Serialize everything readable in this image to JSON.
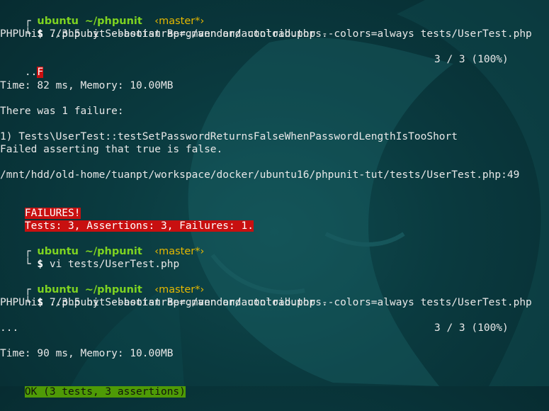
{
  "colors": {
    "prompt_user": "#7ed321",
    "prompt_branch": "#e6b800",
    "failure_bg": "#c81010",
    "ok_bg": "#4e9a06",
    "background": "#0a3a3f"
  },
  "prompt": {
    "user": "ubuntu",
    "path": "~/phpunit",
    "branch": "‹master*›",
    "symbol": "$"
  },
  "run1": {
    "command": "./phpunit --bootstrap=./vendor/autoload.php --colors=always tests/UserTest.php",
    "version_line": "PHPUnit 7.3.5 by Sebastian Bergmann and contributors.",
    "progress_dots": "..",
    "progress_fail": "F",
    "progress_count": "3 / 3 (100%)",
    "time_line": "Time: 82 ms, Memory: 10.00MB",
    "failure_header": "There was 1 failure:",
    "failure_test": "1) Tests\\UserTest::testSetPasswordReturnsFalseWhenPasswordLengthIsTooShort",
    "failure_message": "Failed asserting that true is false.",
    "failure_path": "/mnt/hdd/old-home/tuanpt/workspace/docker/ubuntu16/phpunit-tut/tests/UserTest.php:49",
    "failures_label": "FAILURES!",
    "summary": "Tests: 3, Assertions: 3, Failures: 1."
  },
  "run2": {
    "command": "vi tests/UserTest.php"
  },
  "run3": {
    "command": "./phpunit --bootstrap=./vendor/autoload.php --colors=always tests/UserTest.php",
    "version_line": "PHPUnit 7.3.5 by Sebastian Bergmann and contributors.",
    "progress_dots": "...",
    "progress_count": "3 / 3 (100%)",
    "time_line": "Time: 90 ms, Memory: 10.00MB",
    "ok_summary": "OK (3 tests, 3 assertions)"
  }
}
